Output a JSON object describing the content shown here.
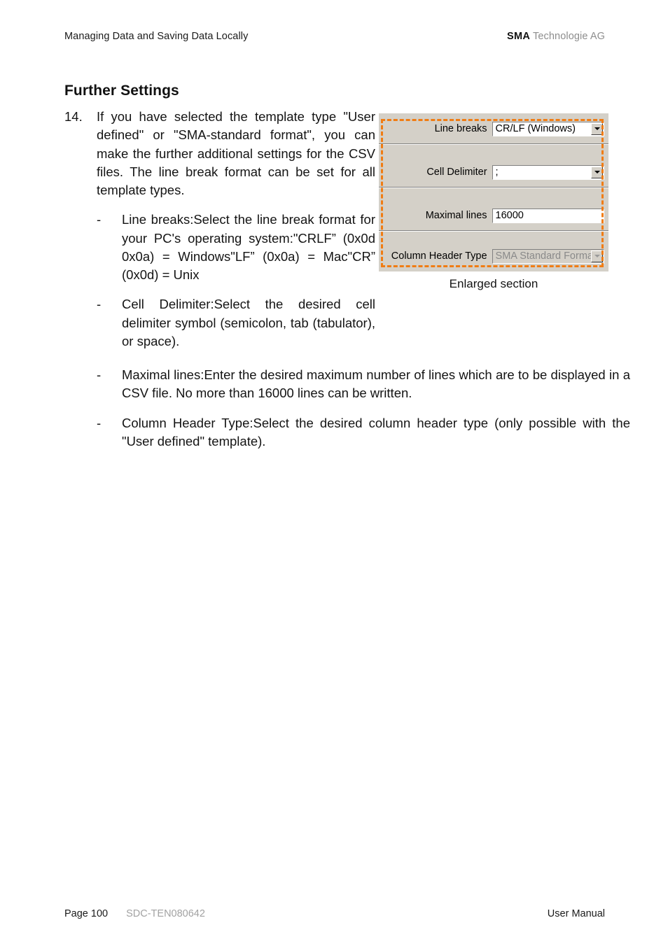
{
  "header": {
    "left_text": "Managing Data and Saving Data Locally",
    "brand": "SMA",
    "brand_suffix": " Technologie AG"
  },
  "content": {
    "section_title": "Further Settings",
    "step": {
      "number": "14.",
      "text": "If you have selected the template type \"User defined\" or \"SMA-standard format\", you can make the further additional settings for the CSV files. The line break format can be set for all template types."
    },
    "bullet_mark": "-",
    "narrow_bullets": [
      {
        "text": "Line breaks:Select the line break format for your PC's operating system:\"CRLF” (0x0d 0x0a) = Windows\"LF” (0x0a) = Mac\"CR” (0x0d) = Unix"
      },
      {
        "text": "Cell Delimiter:Select the desired cell delimiter symbol (semicolon, tab (tabulator), or space)."
      }
    ],
    "wide_bullets": [
      {
        "text": "Maximal lines:Enter the desired maximum number of lines which are to be displayed in a CSV file. No more than 16000 lines can be written."
      },
      {
        "text": "Column Header Type:Select the desired column header type (only possible with the \"User defined\" template)."
      }
    ]
  },
  "figure": {
    "caption": "Enlarged section",
    "highlight_color": "#f07c13",
    "panel_color": "#d4d0c8",
    "fields": [
      {
        "label": "Line breaks",
        "value": "CR/LF (Windows)",
        "control": "combobox",
        "disabled": false
      },
      {
        "label": "Cell Delimiter",
        "value": ";",
        "control": "combobox",
        "disabled": false
      },
      {
        "label": "Maximal lines",
        "value": "16000",
        "control": "textbox",
        "disabled": false
      },
      {
        "label": "Column Header Type",
        "value": "SMA Standard Format",
        "control": "combobox",
        "disabled": true
      }
    ]
  },
  "footer": {
    "page": "Page 100",
    "doc_id": "SDC-TEN080642",
    "manual": "User Manual"
  }
}
